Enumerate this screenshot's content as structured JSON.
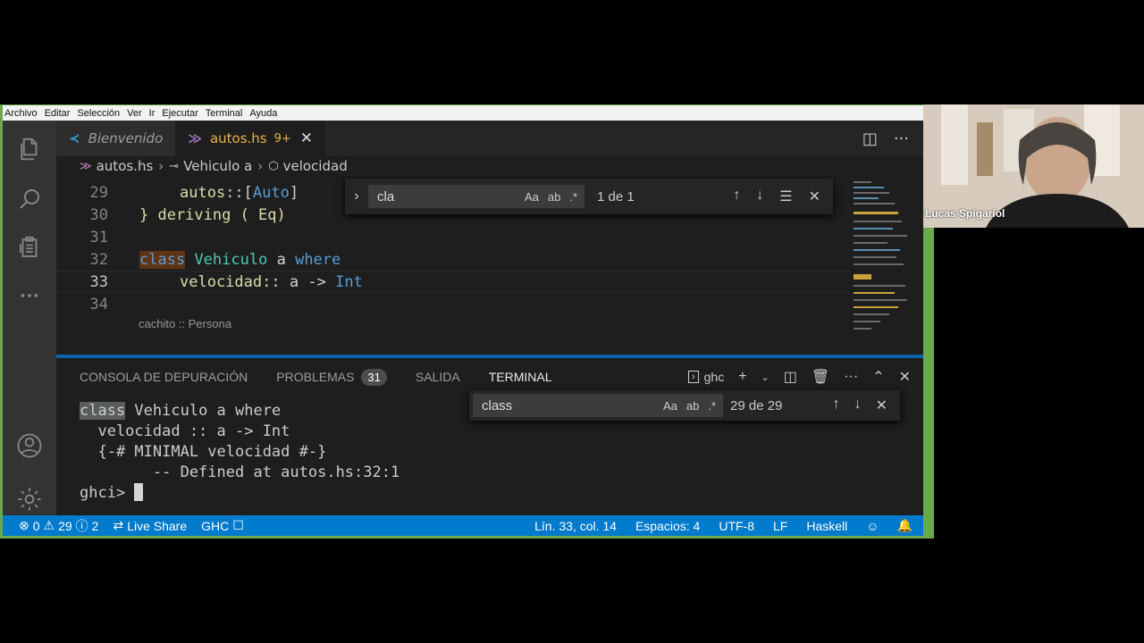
{
  "menubar": [
    "Archivo",
    "Editar",
    "Selección",
    "Ver",
    "Ir",
    "Ejecutar",
    "Terminal",
    "Ayuda"
  ],
  "tabs": [
    {
      "label": "Bienvenido",
      "active": false
    },
    {
      "label": "autos.hs",
      "badge": "9+",
      "active": true
    }
  ],
  "breadcrumbs": {
    "file": "autos.hs",
    "class": "Vehiculo a",
    "member": "velocidad"
  },
  "editor": {
    "lines": [
      {
        "n": "29",
        "text": "autos::[Auto]"
      },
      {
        "n": "30",
        "text": "} deriving ( Eq)"
      },
      {
        "n": "31",
        "text": ""
      },
      {
        "n": "32",
        "kw1": "class",
        "ty": "Vehiculo",
        "var": "a",
        "kw2": "where"
      },
      {
        "n": "33",
        "name": "velocidad::",
        "var": "a",
        "arrow": "->",
        "ty": "Int"
      },
      {
        "n": "34",
        "text": ""
      }
    ],
    "codelens": "cachito :: Persona",
    "find": {
      "query": "cla",
      "count": "1 de 1",
      "opt_case": "Aa",
      "opt_word": "ab",
      "opt_regex": ".*"
    }
  },
  "panel": {
    "tabs": [
      {
        "label": "CONSOLA DE DEPURACIÓN"
      },
      {
        "label": "PROBLEMAS",
        "badge": "31"
      },
      {
        "label": "SALIDA"
      },
      {
        "label": "TERMINAL",
        "active": true
      }
    ],
    "shell": "ghc",
    "terminal": {
      "l1_kw": "class",
      "l1_rest": " Vehiculo a where",
      "l2": "  velocidad :: a -> Int",
      "l3": "  {-# MINIMAL velocidad #-}",
      "l4": "        -- Defined at autos.hs:32:1",
      "prompt": "ghci> "
    },
    "find": {
      "query": "class",
      "count": "29 de 29",
      "opt_case": "Aa",
      "opt_word": "ab",
      "opt_regex": ".*"
    }
  },
  "statusbar": {
    "errors": "0",
    "warnings": "29",
    "infos": "2",
    "liveshare": "Live Share",
    "ghc": "GHC",
    "position": "Lín. 33, col. 14",
    "spaces": "Espacios: 4",
    "encoding": "UTF-8",
    "eol": "LF",
    "language": "Haskell"
  },
  "webcam": {
    "name": "Lucas Spigariol"
  }
}
